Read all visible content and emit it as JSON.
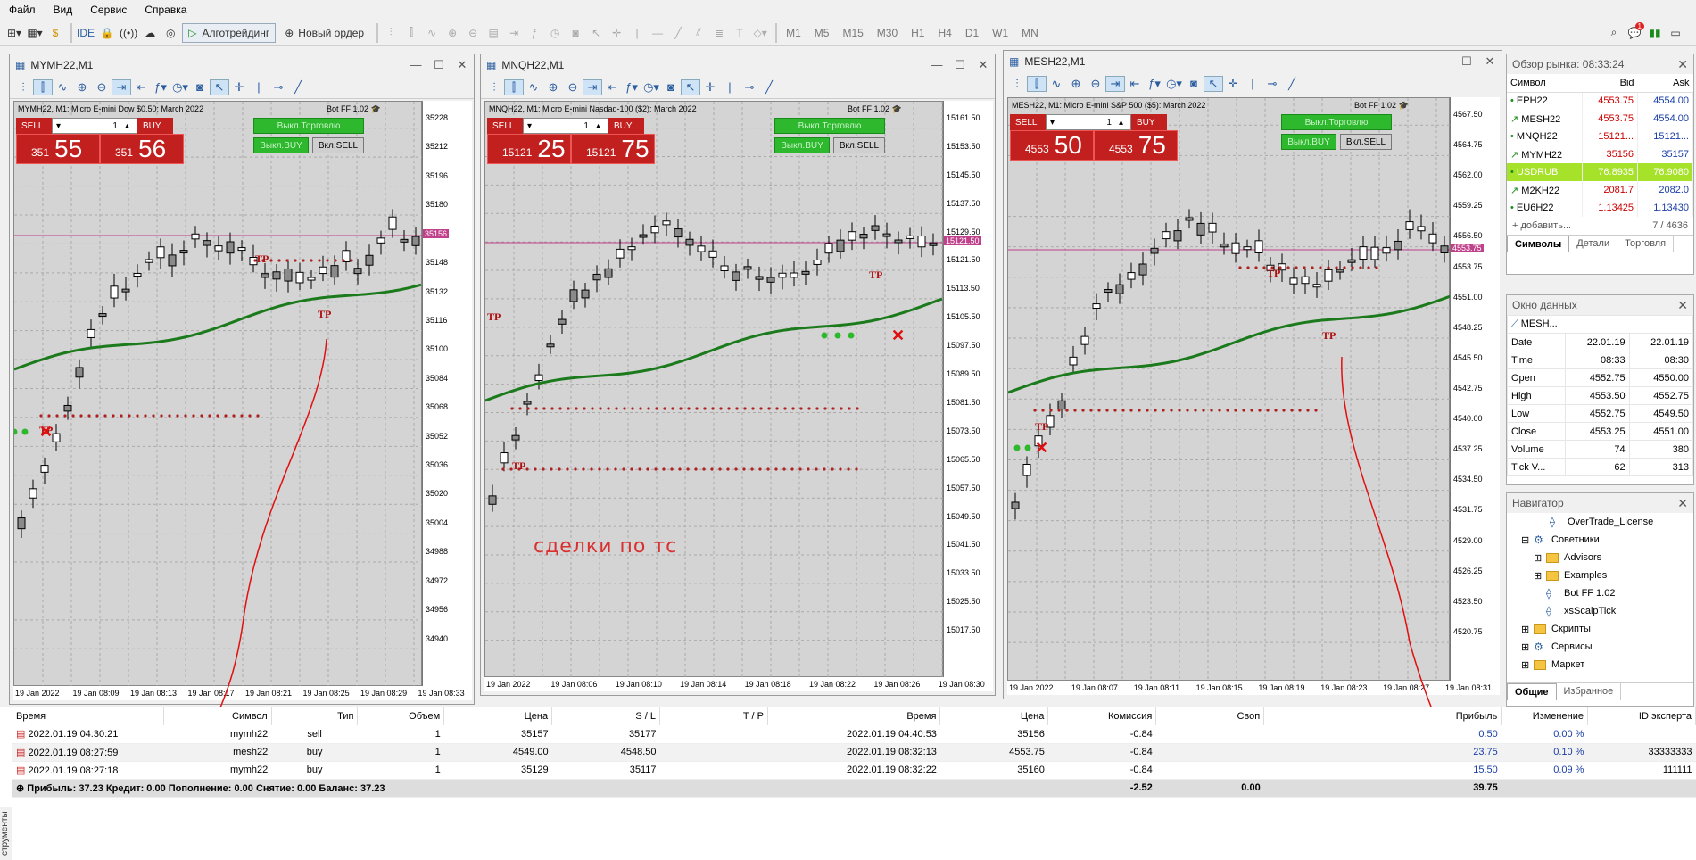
{
  "menu": [
    "Файл",
    "Вид",
    "Сервис",
    "Справка"
  ],
  "toolbar": {
    "ide": "IDE",
    "algo": "Алготрейдинг",
    "new_order": "Новый ордер",
    "timeframes": [
      "M1",
      "M5",
      "M15",
      "M30",
      "H1",
      "H4",
      "D1",
      "W1",
      "MN"
    ],
    "notif_count": "1"
  },
  "charts": [
    {
      "title": "MYMH22,M1",
      "desc": "MYMH22, M1:  Micro E-mini Dow $0.50: March 2022",
      "bot": "Bot FF 1.02",
      "lot": "1",
      "sell_small": "351",
      "sell_big": "55",
      "buy_small": "351",
      "buy_big": "56",
      "sell_label": "SELL",
      "buy_label": "BUY",
      "trade_btn": "Выкл.Торговлю",
      "buy_btn": "Выкл.BUY",
      "sell_btn": "Вкл.SELL",
      "y_labels": [
        "35228",
        "35212",
        "35196",
        "35180",
        "35164",
        "35148",
        "35132",
        "35116",
        "35100",
        "35084",
        "35068",
        "35052",
        "35036",
        "35020",
        "35004",
        "34988",
        "34972",
        "34956",
        "34940"
      ],
      "price_tag": "35156",
      "x_labels": [
        "19 Jan 2022",
        "19 Jan 08:09",
        "19 Jan 08:13",
        "19 Jan 08:17",
        "19 Jan 08:21",
        "19 Jan 08:25",
        "19 Jan 08:29",
        "19 Jan 08:33"
      ]
    },
    {
      "title": "MNQH22,M1",
      "desc": "MNQH22, M1:  Micro E-mini Nasdaq-100 ($2): March 2022",
      "bot": "Bot FF 1.02",
      "lot": "1",
      "sell_small": "15121",
      "sell_big": "25",
      "buy_small": "15121",
      "buy_big": "75",
      "sell_label": "SELL",
      "buy_label": "BUY",
      "trade_btn": "Выкл.Торговлю",
      "buy_btn": "Выкл.BUY",
      "sell_btn": "Вкл.SELL",
      "y_labels": [
        "15161.50",
        "15153.50",
        "15145.50",
        "15137.50",
        "15129.50",
        "15121.50",
        "15113.50",
        "15105.50",
        "15097.50",
        "15089.50",
        "15081.50",
        "15073.50",
        "15065.50",
        "15057.50",
        "15049.50",
        "15041.50",
        "15033.50",
        "15025.50",
        "15017.50"
      ],
      "price_tag": "15121.50",
      "x_labels": [
        "19 Jan 2022",
        "19 Jan 08:06",
        "19 Jan 08:10",
        "19 Jan 08:14",
        "19 Jan 08:18",
        "19 Jan 08:22",
        "19 Jan 08:26",
        "19 Jan 08:30"
      ]
    },
    {
      "title": "MESH22,M1",
      "desc": "MESH22, M1:  Micro E-mini S&P 500 ($5): March 2022",
      "bot": "Bot FF 1.02",
      "lot": "1",
      "sell_small": "4553",
      "sell_big": "50",
      "buy_small": "4553",
      "buy_big": "75",
      "sell_label": "SELL",
      "buy_label": "BUY",
      "trade_btn": "Выкл.Торговлю",
      "buy_btn": "Выкл.BUY",
      "sell_btn": "Вкл.SELL",
      "y_labels": [
        "4567.50",
        "4564.75",
        "4562.00",
        "4559.25",
        "4556.50",
        "4553.75",
        "4551.00",
        "4548.25",
        "4545.50",
        "4542.75",
        "4540.00",
        "4537.25",
        "4534.50",
        "4531.75",
        "4529.00",
        "4526.25",
        "4523.50",
        "4520.75"
      ],
      "price_tag": "4553.75",
      "x_labels": [
        "19 Jan 2022",
        "19 Jan 08:07",
        "19 Jan 08:11",
        "19 Jan 08:15",
        "19 Jan 08:19",
        "19 Jan 08:23",
        "19 Jan 08:27",
        "19 Jan 08:31"
      ]
    }
  ],
  "annotation": "сделки по тс",
  "tp": "TP",
  "market_watch": {
    "title": "Обзор рынка: 08:33:24",
    "cols": [
      "Символ",
      "Bid",
      "Ask"
    ],
    "rows": [
      {
        "sym": "EPH22",
        "bid": "4553.75",
        "ask": "4554.00"
      },
      {
        "sym": "MESH22",
        "bid": "4553.75",
        "ask": "4554.00"
      },
      {
        "sym": "MNQH22",
        "bid": "15121...",
        "ask": "15121..."
      },
      {
        "sym": "MYMH22",
        "bid": "35156",
        "ask": "35157"
      },
      {
        "sym": "USDRUB",
        "bid": "76.8935",
        "ask": "76.9080"
      },
      {
        "sym": "M2KH22",
        "bid": "2081.7",
        "ask": "2082.0"
      },
      {
        "sym": "EU6H22",
        "bid": "1.13425",
        "ask": "1.13430"
      }
    ],
    "add": "добавить...",
    "count": "7 / 4636",
    "tabs": [
      "Символы",
      "Детали",
      "Торговля"
    ]
  },
  "data_window": {
    "title": "Окно данных",
    "symbol": "MESH...",
    "rows": [
      [
        "Date",
        "22.01.19",
        "22.01.19"
      ],
      [
        "Time",
        "08:33",
        "08:30"
      ],
      [
        "Open",
        "4552.75",
        "4550.00"
      ],
      [
        "High",
        "4553.50",
        "4552.75"
      ],
      [
        "Low",
        "4552.75",
        "4549.50"
      ],
      [
        "Close",
        "4553.25",
        "4551.00"
      ],
      [
        "Volume",
        "74",
        "380"
      ],
      [
        "Tick V...",
        "62",
        "313"
      ]
    ]
  },
  "navigator": {
    "title": "Навигатор",
    "items": [
      "OverTrade_License",
      "Советники",
      "Advisors",
      "Examples",
      "Bot FF 1.02",
      "xsScalpTick",
      "Скрипты",
      "Сервисы",
      "Маркет"
    ],
    "tabs": [
      "Общие",
      "Избранное"
    ]
  },
  "trades": {
    "headers": [
      "Время",
      "Символ",
      "Тип",
      "Объем",
      "Цена",
      "S / L",
      "T / P",
      "Время",
      "Цена",
      "Комиссия",
      "Своп",
      "Прибыль",
      "Изменение",
      "ID эксперта"
    ],
    "rows": [
      [
        "2022.01.19 04:30:21",
        "mymh22",
        "sell",
        "1",
        "35157",
        "35177",
        "",
        "2022.01.19 04:40:53",
        "35156",
        "-0.84",
        "",
        "0.50",
        "0.00 %",
        ""
      ],
      [
        "2022.01.19 08:27:59",
        "mesh22",
        "buy",
        "1",
        "4549.00",
        "4548.50",
        "",
        "2022.01.19 08:32:13",
        "4553.75",
        "-0.84",
        "",
        "23.75",
        "0.10 %",
        "33333333"
      ],
      [
        "2022.01.19 08:27:18",
        "mymh22",
        "buy",
        "1",
        "35129",
        "35117",
        "",
        "2022.01.19 08:32:22",
        "35160",
        "-0.84",
        "",
        "15.50",
        "0.09 %",
        "111111"
      ]
    ],
    "summary": "Прибыль: 37.23  Кредит: 0.00  Пополнение: 0.00  Снятие: 0.00  Баланс: 37.23",
    "total_comm": "-2.52",
    "total_swap": "0.00",
    "total_profit": "39.75",
    "side_tab": "струменты"
  },
  "colors": {
    "sell": "#c21f1f",
    "ma": "#1b7a1b",
    "level": "#c0408a",
    "dots": "#b02020"
  }
}
